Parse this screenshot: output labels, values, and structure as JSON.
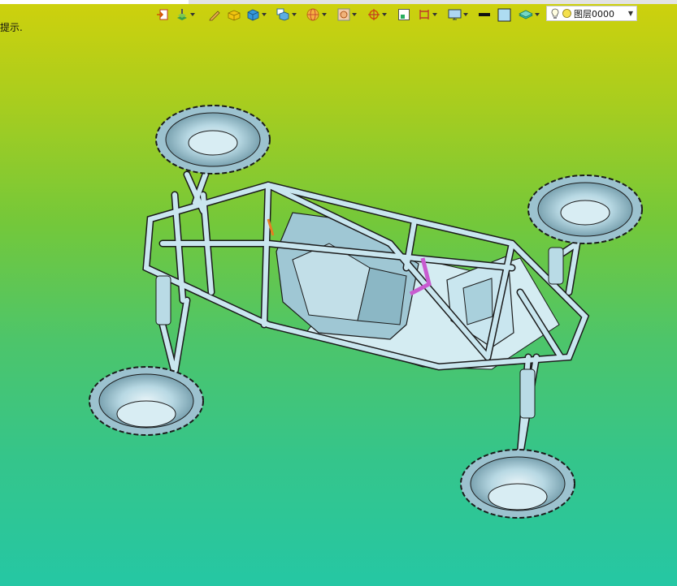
{
  "hint": {
    "text": "提示."
  },
  "toolbar": {
    "items": [
      {
        "icon": "import-icon",
        "dropdown": false
      },
      {
        "icon": "layer-stack-icon",
        "dropdown": true
      },
      {
        "icon": "pencil-icon",
        "dropdown": false
      },
      {
        "icon": "box-solid-icon",
        "dropdown": false
      },
      {
        "icon": "cube-icon",
        "dropdown": true
      },
      {
        "icon": "cube-view-icon",
        "dropdown": true
      },
      {
        "icon": "sphere-wire-icon",
        "dropdown": true
      },
      {
        "icon": "image-view-icon",
        "dropdown": true
      },
      {
        "icon": "target-icon",
        "dropdown": true
      },
      {
        "icon": "small-window-icon",
        "dropdown": false
      },
      {
        "icon": "dimension-icon",
        "dropdown": true
      },
      {
        "icon": "monitor-icon",
        "dropdown": true
      },
      {
        "icon": "line-color-icon",
        "dropdown": false
      },
      {
        "icon": "fill-color-icon",
        "dropdown": false
      },
      {
        "icon": "layer-icon",
        "dropdown": true
      }
    ]
  },
  "layer": {
    "label": "图层0000",
    "icons": [
      "lightbulb-icon",
      "sun-icon"
    ]
  },
  "colors": {
    "bg_top": "#cfd10c",
    "bg_bottom": "#25c7a4",
    "model": "#c9e6ef",
    "edge": "#1b1b1b"
  }
}
